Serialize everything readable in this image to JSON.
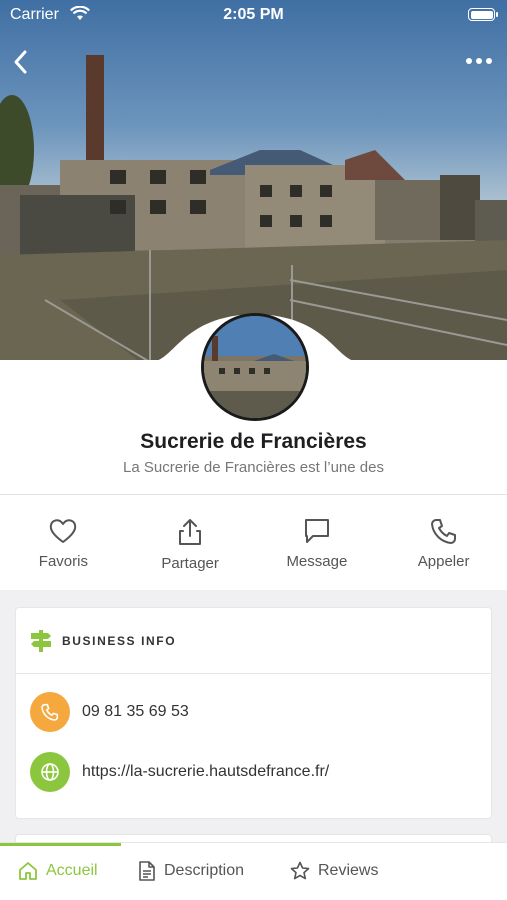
{
  "status_bar": {
    "carrier": "Carrier",
    "time": "2:05 PM"
  },
  "place": {
    "name": "Sucrerie de Francières",
    "summary": "La Sucrerie de Francières est l’une des"
  },
  "actions": [
    {
      "label": "Favoris",
      "icon": "heart-icon"
    },
    {
      "label": "Partager",
      "icon": "share-icon"
    },
    {
      "label": "Message",
      "icon": "message-icon"
    },
    {
      "label": "Appeler",
      "icon": "phone-icon"
    }
  ],
  "business_info": {
    "title": "BUSINESS INFO",
    "phone": "09 81 35 69 53",
    "website": "https://la-sucrerie.hautsdefrance.fr/"
  },
  "tabs": [
    {
      "label": "Accueil",
      "icon": "home-icon",
      "active": true
    },
    {
      "label": "Description",
      "icon": "document-icon",
      "active": false
    },
    {
      "label": "Reviews",
      "icon": "star-icon",
      "active": false
    }
  ],
  "colors": {
    "accent": "#8cc63f",
    "phone_circle": "#f5a83d",
    "web_circle": "#8cc63f"
  }
}
